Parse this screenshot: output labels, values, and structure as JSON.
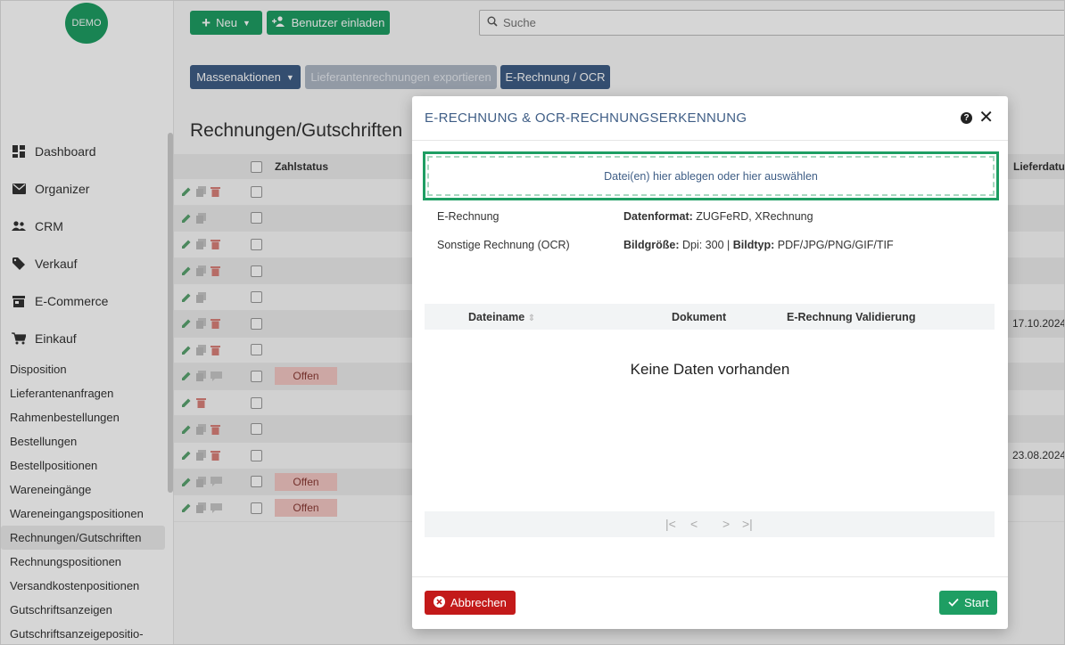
{
  "logo": "DEMO",
  "toolbar": {
    "new_label": "Neu",
    "invite_label": "Benutzer einladen",
    "search_placeholder": "Suche",
    "mass_actions_label": "Massenaktionen",
    "export_label": "Lieferantenrechnungen exportieren",
    "einvoice_label": "E-Rechnung / OCR"
  },
  "page_title": "Rechnungen/Gutschriften",
  "sidebar": {
    "items": [
      {
        "label": "Dashboard",
        "icon": "dashboard-icon"
      },
      {
        "label": "Organizer",
        "icon": "mail-icon"
      },
      {
        "label": "CRM",
        "icon": "users-icon"
      },
      {
        "label": "Verkauf",
        "icon": "tag-icon"
      },
      {
        "label": "E-Commerce",
        "icon": "store-icon"
      },
      {
        "label": "Einkauf",
        "icon": "cart-icon"
      }
    ],
    "sub_items": [
      "Disposition",
      "Lieferantenanfragen",
      "Rahmenbestellungen",
      "Bestellungen",
      "Bestellpositionen",
      "Wareneingänge",
      "Wareneingangspositionen",
      "Rechnungen/Gutschriften",
      "Rechnungspositionen",
      "Versandkostenpositionen",
      "Gutschriftsanzeigen",
      "Gutschriftsanzeigepositio-"
    ]
  },
  "table": {
    "col_zahlstatus": "Zahlstatus",
    "col_lieferdatum": "Lieferdatu",
    "badge_offen": "Offen",
    "dates": [
      "17.10.2024",
      "23.08.2024"
    ]
  },
  "modal": {
    "title": "E-RECHNUNG & OCR-RECHNUNGSERKENNUNG",
    "help": "?",
    "close": "✕",
    "drop_text": "Datei(en) hier ablegen oder hier auswählen",
    "einvoice_label": "E-Rechnung",
    "einvoice_key": "Datenformat:",
    "einvoice_val": " ZUGFeRD, XRechnung",
    "ocr_label": "Sonstige Rechnung (OCR)",
    "ocr_key1": "Bildgröße:",
    "ocr_val1": " Dpi: 300 | ",
    "ocr_key2": "Bildtyp:",
    "ocr_val2": " PDF/JPG/PNG/GIF/TIF",
    "col_filename": "Dateiname",
    "col_document": "Dokument",
    "col_validation": "E-Rechnung Validierung",
    "no_data": "Keine Daten vorhanden",
    "cancel_label": "Abbrechen",
    "start_label": "Start"
  }
}
